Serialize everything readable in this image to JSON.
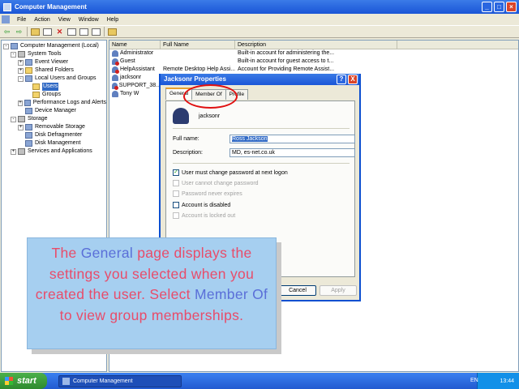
{
  "window": {
    "title": "Computer Management"
  },
  "menu": [
    "File",
    "Action",
    "View",
    "Window",
    "Help"
  ],
  "tree": [
    {
      "label": "Computer Management (Local)",
      "level": 0,
      "exp": "−",
      "icon": "computer"
    },
    {
      "label": "System Tools",
      "level": 1,
      "exp": "−",
      "icon": "tool"
    },
    {
      "label": "Event Viewer",
      "level": 2,
      "exp": "+",
      "icon": "app"
    },
    {
      "label": "Shared Folders",
      "level": 2,
      "exp": "+",
      "icon": "fold"
    },
    {
      "label": "Local Users and Groups",
      "level": 2,
      "exp": "−",
      "icon": "app"
    },
    {
      "label": "Users",
      "level": 3,
      "exp": "",
      "icon": "fold",
      "selected": true
    },
    {
      "label": "Groups",
      "level": 3,
      "exp": "",
      "icon": "fold"
    },
    {
      "label": "Performance Logs and Alerts",
      "level": 2,
      "exp": "+",
      "icon": "app"
    },
    {
      "label": "Device Manager",
      "level": 2,
      "exp": "",
      "icon": "app"
    },
    {
      "label": "Storage",
      "level": 1,
      "exp": "−",
      "icon": "tool"
    },
    {
      "label": "Removable Storage",
      "level": 2,
      "exp": "+",
      "icon": "app"
    },
    {
      "label": "Disk Defragmenter",
      "level": 2,
      "exp": "",
      "icon": "app"
    },
    {
      "label": "Disk Management",
      "level": 2,
      "exp": "",
      "icon": "app"
    },
    {
      "label": "Services and Applications",
      "level": 1,
      "exp": "+",
      "icon": "tool"
    }
  ],
  "list": {
    "columns": [
      "Name",
      "Full Name",
      "Description"
    ],
    "rows": [
      {
        "name": "Administrator",
        "full": "",
        "desc": "Built-in account for administering the...",
        "disabled": false
      },
      {
        "name": "Guest",
        "full": "",
        "desc": "Built-in account for guest access to t...",
        "disabled": true
      },
      {
        "name": "HelpAssistant",
        "full": "Remote Desktop Help Assi...",
        "desc": "Account for Providing Remote Assist...",
        "disabled": true
      },
      {
        "name": "jacksonr",
        "full": "",
        "desc": "",
        "disabled": false
      },
      {
        "name": "SUPPORT_38...",
        "full": "",
        "desc": "",
        "disabled": true
      },
      {
        "name": "Tony W",
        "full": "",
        "desc": "",
        "disabled": false
      }
    ]
  },
  "dialog": {
    "title": "Jacksonr Properties",
    "help_btn": "?",
    "close_btn": "X",
    "tabs": [
      "General",
      "Member Of",
      "Profile"
    ],
    "username": "jacksonr",
    "full_name_label": "Full name:",
    "full_name_value": "Ross Jackson",
    "description_label": "Description:",
    "description_value": "MD, es-net.co.uk",
    "checks": [
      {
        "label": "User must change password at next logon",
        "checked": true,
        "enabled": true
      },
      {
        "label": "User cannot change password",
        "checked": false,
        "enabled": false
      },
      {
        "label": "Password never expires",
        "checked": false,
        "enabled": false
      },
      {
        "label": "Account is disabled",
        "checked": false,
        "enabled": true
      },
      {
        "label": "Account is locked out",
        "checked": false,
        "enabled": false
      }
    ],
    "buttons": {
      "cancel": "Cancel",
      "apply": "Apply"
    }
  },
  "callout": {
    "t1": "The ",
    "t2": "General",
    "t3": " page displays the settings you selected when you created the user. Select ",
    "t4": "Member Of",
    "t5": " to view group memberships."
  },
  "taskbar": {
    "start": "start",
    "task": "Computer Management",
    "lang": "EN",
    "clock": "13:44"
  }
}
